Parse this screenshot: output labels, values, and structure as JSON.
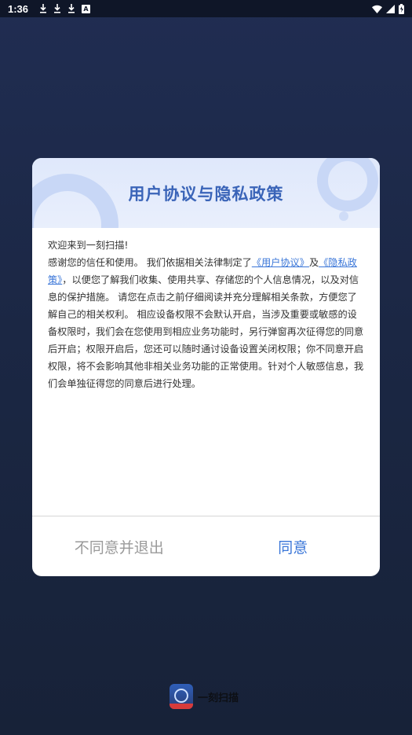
{
  "status_bar": {
    "time": "1:36",
    "a_badge": "A"
  },
  "dialog": {
    "title": "用户协议与隐私政策",
    "greeting": "欢迎来到一刻扫描!",
    "body_part1": " 感谢您的信任和使用。 我们依据相关法律制定了",
    "link_user_agreement": "《用户协议》",
    "and_text": "及",
    "link_privacy_policy": "《隐私政策》",
    "body_part2": "，以便您了解我们收集、使用共享、存储您的个人信息情况，以及对信息的保护措施。 请您在点击之前仔细阅读并充分理解相关条款，方便您了解自己的相关权利。 相应设备权限不会默认开启，当涉及重要或敏感的设备权限时，我们会在您使用到相应业务功能时，另行弹窗再次征得您的同意后开启；权限开启后，您还可以随时通讨设备设置关闭权限；你不同意开启权限，将不会影响其他非相关业务功能的正常使用。针对个人敏感信息，我们会单独征得您的同意后进行处理。",
    "btn_disagree": "不同意并退出",
    "btn_agree": "同意"
  },
  "footer": {
    "app_name": "一刻扫描"
  },
  "colors": {
    "accent": "#3a76d8",
    "title": "#3a64b8",
    "background": "#1b2744"
  }
}
